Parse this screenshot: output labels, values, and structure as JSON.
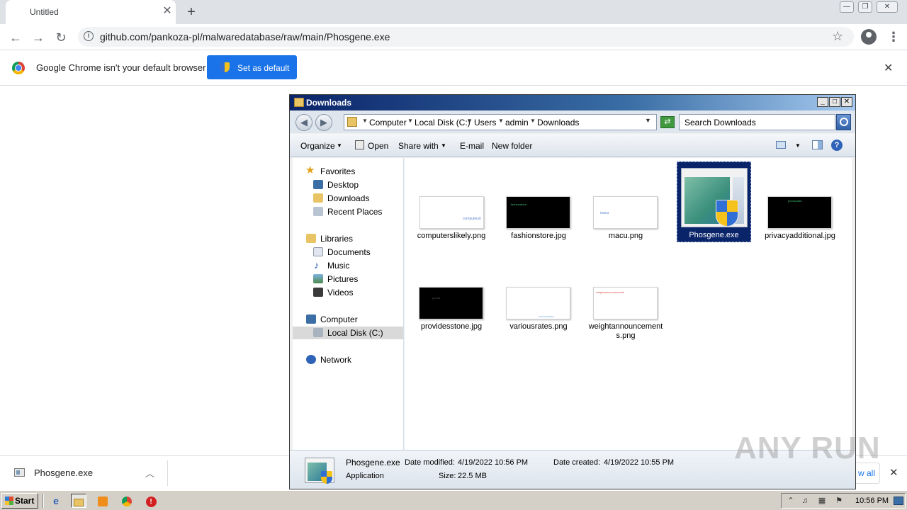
{
  "chrome": {
    "tab_title": "Untitled",
    "tab_close": "✕",
    "new_tab": "+",
    "window_controls": [
      "—",
      "❐",
      "✕"
    ],
    "nav": {
      "back": "←",
      "forward": "→",
      "reload": "↻"
    },
    "url": "github.com/pankoza-pl/malwaredatabase/raw/main/Phosgene.exe",
    "bookmark_star": "☆",
    "menu": "⋮",
    "infobar": {
      "message": "Google Chrome isn't your default browser",
      "button_label": "Set as default",
      "close": "✕"
    },
    "download_shelf": {
      "file_name": "Phosgene.exe",
      "chevron": "︿",
      "show_all_label": "w all",
      "close": "✕"
    }
  },
  "explorer": {
    "title": "Downloads",
    "window_controls": [
      "_",
      "□",
      "✕"
    ],
    "nav_back": "◀",
    "nav_forward": "▶",
    "breadcrumbs": [
      "Computer",
      "Local Disk (C:)",
      "Users",
      "admin",
      "Downloads"
    ],
    "breadcrumb_sep": "▸",
    "dropdown_arrow": "▼",
    "refresh": "⇄",
    "search_placeholder": "Search Downloads",
    "commands": {
      "organize": "Organize",
      "open": "Open",
      "share_with": "Share with",
      "email": "E-mail",
      "new_folder": "New folder",
      "caret": "▼",
      "help": "?"
    },
    "nav_pane": {
      "favorites": "Favorites",
      "favorites_items": [
        "Desktop",
        "Downloads",
        "Recent Places"
      ],
      "libraries": "Libraries",
      "libraries_items": [
        "Documents",
        "Music",
        "Pictures",
        "Videos"
      ],
      "computer": "Computer",
      "computer_items": [
        "Local Disk (C:)"
      ],
      "network": "Network"
    },
    "files": [
      {
        "name": "computerslikely.png",
        "thumb_text": "computersli"
      },
      {
        "name": "fashionstore.jpg",
        "thumb_text": "fashionstore"
      },
      {
        "name": "macu.png",
        "thumb_text": "macu"
      },
      {
        "name": "Phosgene.exe"
      },
      {
        "name": "privacyadditional.jpg",
        "thumb_text": "privacyadd"
      },
      {
        "name": "providesstone.jpg",
        "thumb_text": "provid"
      },
      {
        "name": "variousrates.png",
        "thumb_text": "variousrates"
      },
      {
        "name": "weightannouncements.png",
        "thumb_text": "weightannouncements"
      }
    ],
    "status": {
      "file_name": "Phosgene.exe",
      "file_type": "Application",
      "date_modified_label": "Date modified:",
      "date_modified": "4/19/2022 10:56 PM",
      "date_created_label": "Date created:",
      "date_created": "4/19/2022 10:55 PM",
      "size_label": "Size:",
      "size": "22.5 MB"
    }
  },
  "watermark": "ANY RUN",
  "taskbar": {
    "start_label": "Start",
    "clock": "10:56 PM"
  }
}
